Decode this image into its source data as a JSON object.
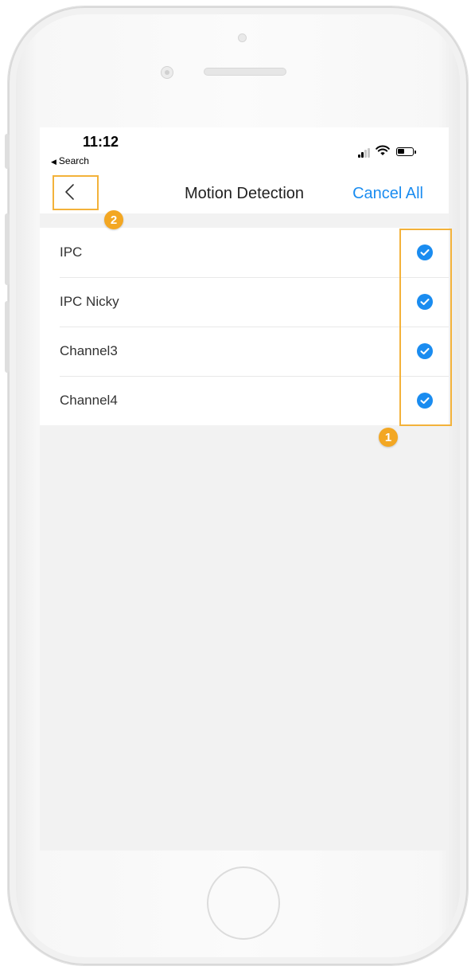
{
  "status_bar": {
    "time": "11:12",
    "back_app": "Search",
    "icons": [
      "signal-icon",
      "wifi-icon",
      "battery-icon"
    ]
  },
  "nav": {
    "back_icon": "chevron-left-icon",
    "title": "Motion Detection",
    "cancel_all": "Cancel All"
  },
  "channels": [
    {
      "label": "IPC",
      "checked": true
    },
    {
      "label": "IPC Nicky",
      "checked": true
    },
    {
      "label": "Channel3",
      "checked": true
    },
    {
      "label": "Channel4",
      "checked": true
    }
  ],
  "annotations": {
    "badge_1": "1",
    "badge_2": "2"
  },
  "colors": {
    "accent": "#1a8cf0",
    "annotation": "#f3a723",
    "background": "#f2f2f2"
  }
}
